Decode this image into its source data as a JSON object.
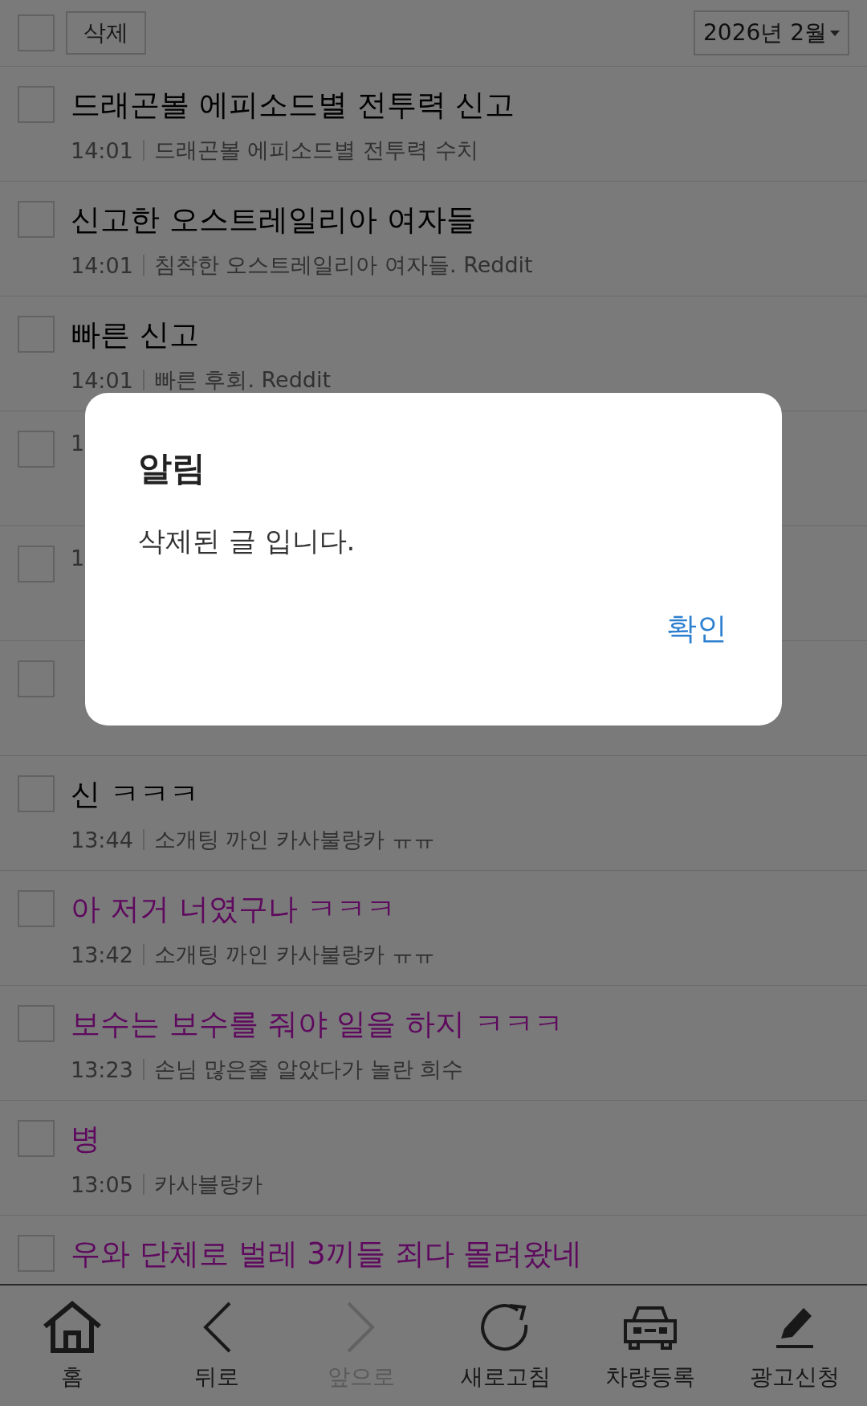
{
  "toolbar": {
    "select_all": {
      "checked": false
    },
    "delete_button": "삭제",
    "month_select": "2026년 2월"
  },
  "posts": [
    {
      "title": "드래곤볼 에피소드별 전투력 신고",
      "time": "14:01",
      "source": "드래곤볼 에피소드별 전투력 수치",
      "visited": false,
      "checked": false
    },
    {
      "title": "신고한 오스트레일리아 여자들",
      "time": "14:01",
      "source": "침착한 오스트레일리아 여자들. Reddit",
      "visited": false,
      "checked": false
    },
    {
      "title": "빠른 신고",
      "time": "14:01",
      "source": "빠른 후회. Reddit",
      "visited": false,
      "checked": false
    },
    {
      "time": "1",
      "checked": false
    },
    {
      "time": "1",
      "checked": false
    },
    {
      "checked": false
    },
    {
      "title": "신 ㅋㅋㅋ",
      "time": "13:44",
      "source": "소개팅 까인 카사불랑카 ㅠㅠ",
      "visited": false,
      "checked": false
    },
    {
      "title": "아 저거 너였구나 ㅋㅋㅋ",
      "time": "13:42",
      "source": "소개팅 까인 카사불랑카 ㅠㅠ",
      "visited": true,
      "checked": false
    },
    {
      "title": "보수는 보수를 줘야 일을 하지 ㅋㅋㅋ",
      "time": "13:23",
      "source": "손님 많은줄 알았다가 놀란 희수",
      "visited": true,
      "checked": false
    },
    {
      "title": "병",
      "time": "13:05",
      "source": "카사블랑카",
      "visited": true,
      "checked": false
    },
    {
      "title": "우와 단체로 벌레 3끼들 죄다 몰려왔네",
      "visited": true,
      "checked": false
    }
  ],
  "bottom_nav": [
    {
      "kind": "home",
      "label": "홈",
      "disabled": false
    },
    {
      "kind": "back",
      "label": "뒤로",
      "disabled": false
    },
    {
      "kind": "forward",
      "label": "앞으로",
      "disabled": true
    },
    {
      "kind": "refresh",
      "label": "새로고침",
      "disabled": false
    },
    {
      "kind": "car",
      "label": "차량등록",
      "disabled": false
    },
    {
      "kind": "pen",
      "label": "광고신청",
      "disabled": false
    }
  ],
  "dialog": {
    "title": "알림",
    "message": "삭제된 글 입니다.",
    "confirm": "확인"
  }
}
